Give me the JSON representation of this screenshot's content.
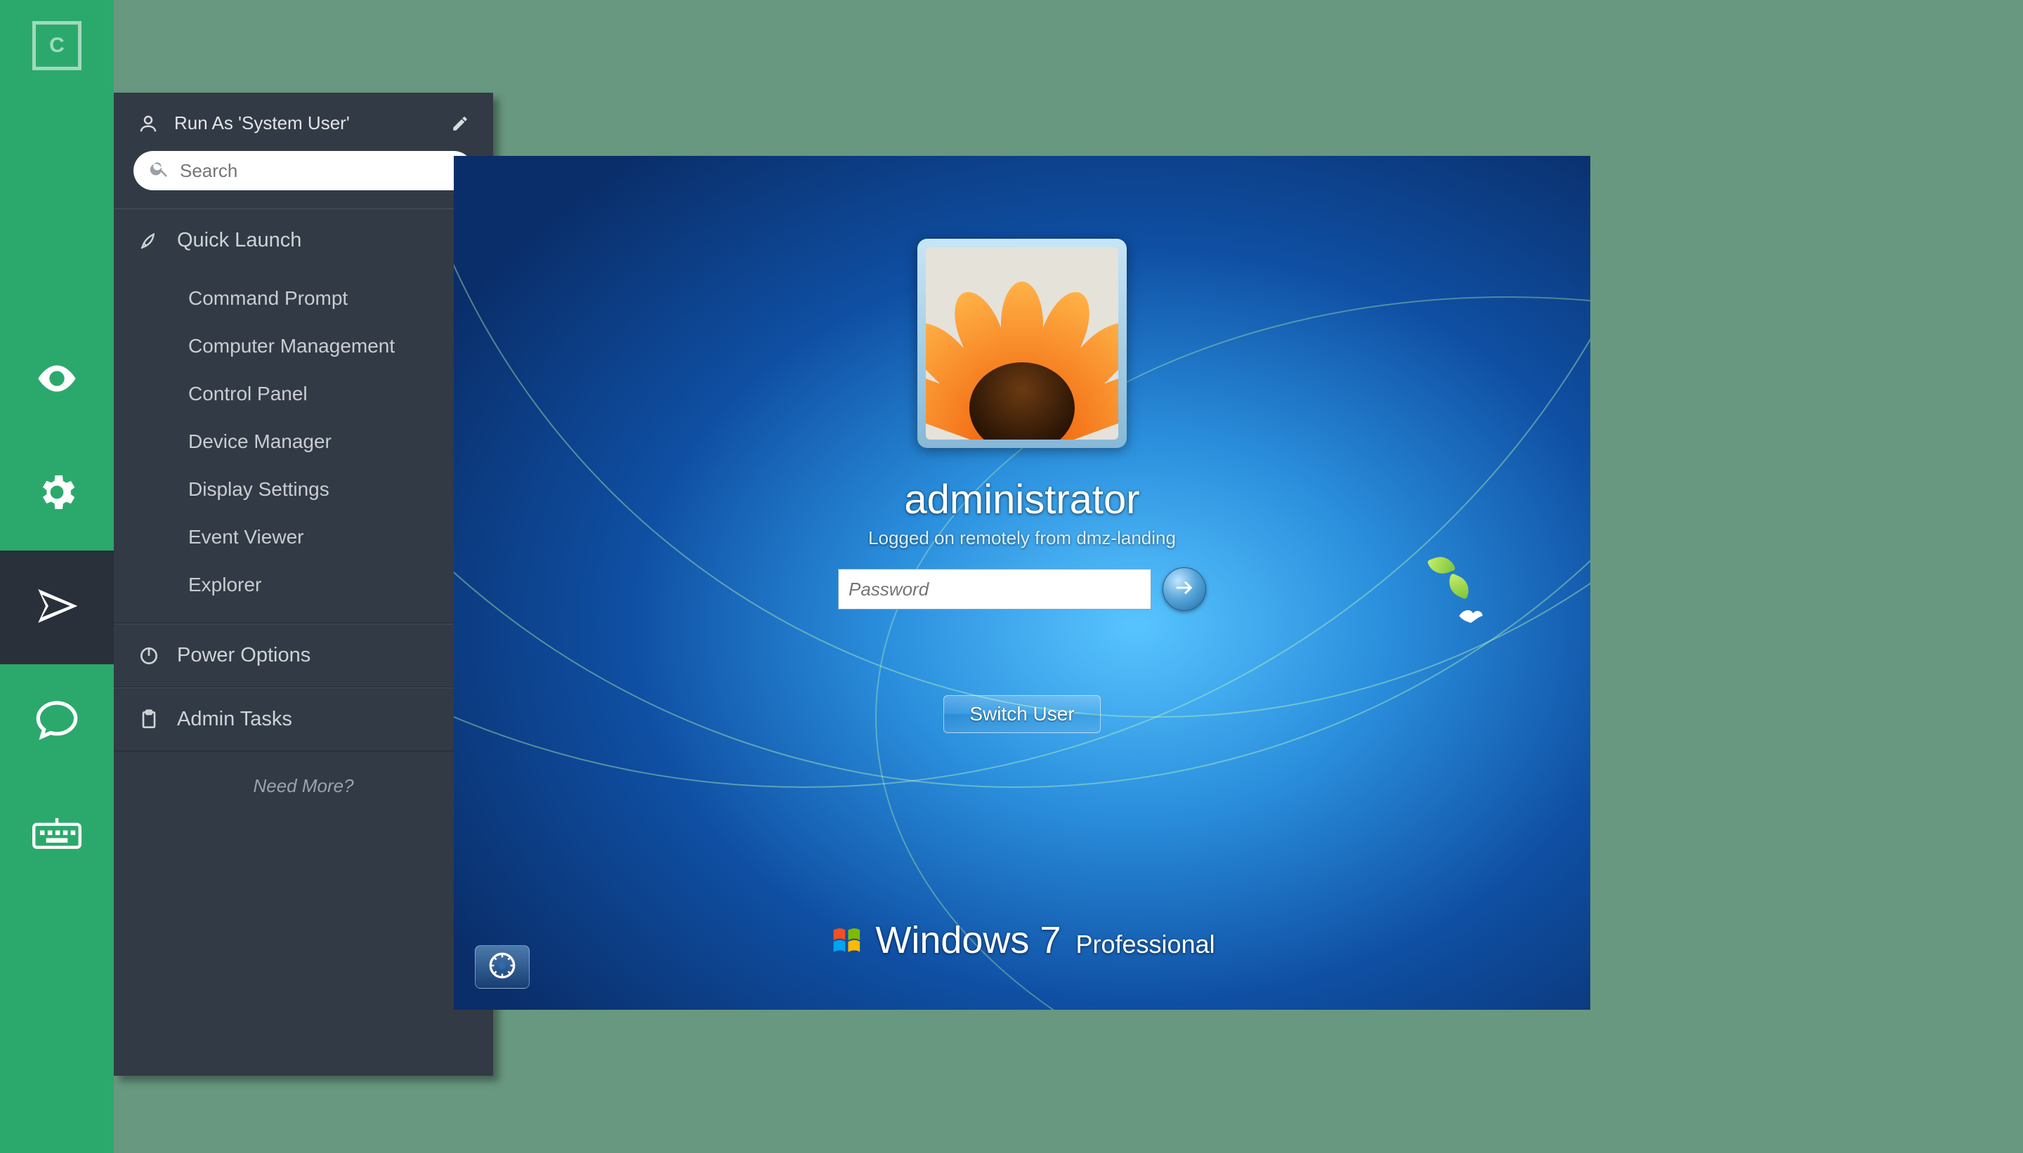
{
  "colors": {
    "accent": "#2BA96C",
    "panel": "#323A45"
  },
  "rail": {
    "icons": [
      "eye-icon",
      "gear-icon",
      "send-icon",
      "chat-icon",
      "keyboard-icon"
    ],
    "active": "send-icon"
  },
  "panel": {
    "run_as_label": "Run As 'System User'",
    "search_placeholder": "Search",
    "sections": {
      "quick_launch": {
        "label": "Quick Launch",
        "expanded": true,
        "items": [
          "Command Prompt",
          "Computer Management",
          "Control Panel",
          "Device Manager",
          "Display Settings",
          "Event Viewer",
          "Explorer"
        ]
      },
      "power_options": {
        "label": "Power Options",
        "expanded": false
      },
      "admin_tasks": {
        "label": "Admin Tasks",
        "expanded": false
      }
    },
    "need_more": "Need More?"
  },
  "remote": {
    "username": "administrator",
    "logon_msg": "Logged on remotely from dmz-landing",
    "password_placeholder": "Password",
    "switch_user": "Switch User",
    "os_brand": "Windows",
    "os_version": "7",
    "os_edition": "Professional"
  }
}
